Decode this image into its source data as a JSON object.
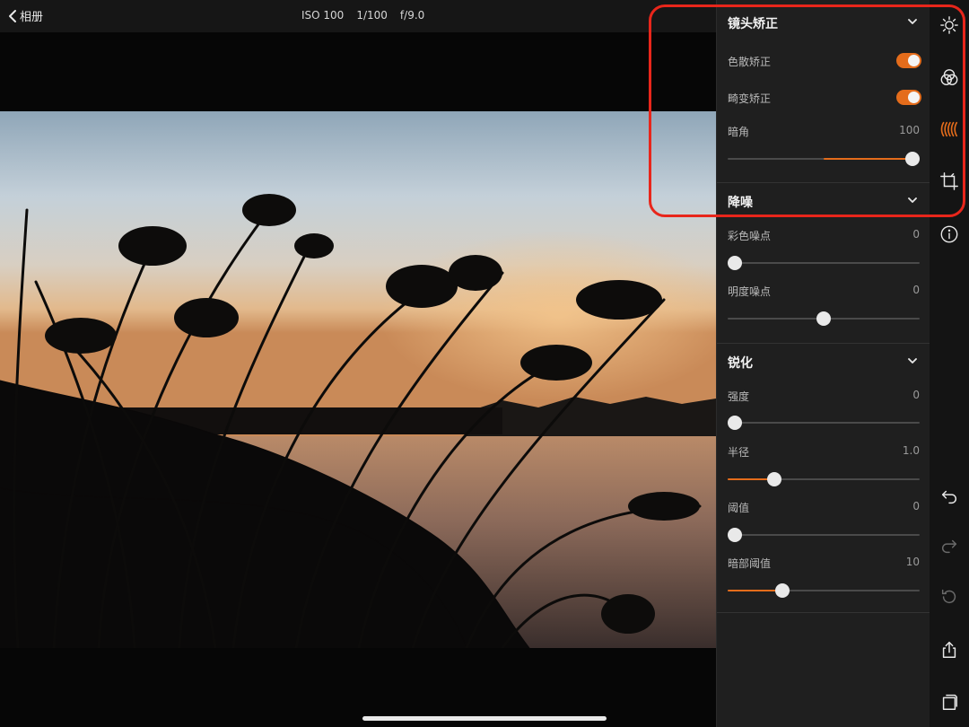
{
  "topbar": {
    "back_label": "相册",
    "exif": {
      "iso": "ISO 100",
      "shutter": "1/100",
      "aperture": "f/9.0"
    }
  },
  "panel": {
    "lens": {
      "title": "镜头矫正",
      "chromatic_label": "色散矫正",
      "chromatic_on": true,
      "distortion_label": "畸变矫正",
      "distortion_on": true,
      "vignette_label": "暗角",
      "vignette_value": "100"
    },
    "noise": {
      "title": "降噪",
      "color_label": "彩色噪点",
      "color_value": "0",
      "luma_label": "明度噪点",
      "luma_value": "0"
    },
    "sharpen": {
      "title": "锐化",
      "strength_label": "强度",
      "strength_value": "0",
      "radius_label": "半径",
      "radius_value": "1.0",
      "threshold_label": "阈值",
      "threshold_value": "0",
      "shadow_threshold_label": "暗部阈值",
      "shadow_threshold_value": "10"
    }
  },
  "sliders": {
    "vignette": {
      "thumb": 1.0,
      "fill_from": 0.5
    },
    "color_noise": {
      "thumb": 0.0,
      "fill_from": null
    },
    "luma_noise": {
      "thumb": 0.5,
      "fill_from": null
    },
    "strength": {
      "thumb": 0.0,
      "fill_from": null
    },
    "radius": {
      "thumb": 0.22,
      "fill_from": 0.0
    },
    "threshold": {
      "thumb": 0.0,
      "fill_from": null
    },
    "shadow_threshold": {
      "thumb": 0.27,
      "fill_from": 0.0
    }
  },
  "tools": [
    "light-icon",
    "color-icon",
    "lens-correction-icon",
    "crop-icon",
    "info-icon",
    "undo-icon",
    "redo-icon",
    "reset-icon",
    "share-icon",
    "versions-icon"
  ],
  "colors": {
    "accent": "#e46c1b",
    "annotation": "#e8261b",
    "panel_bg": "#1f1f1f"
  }
}
